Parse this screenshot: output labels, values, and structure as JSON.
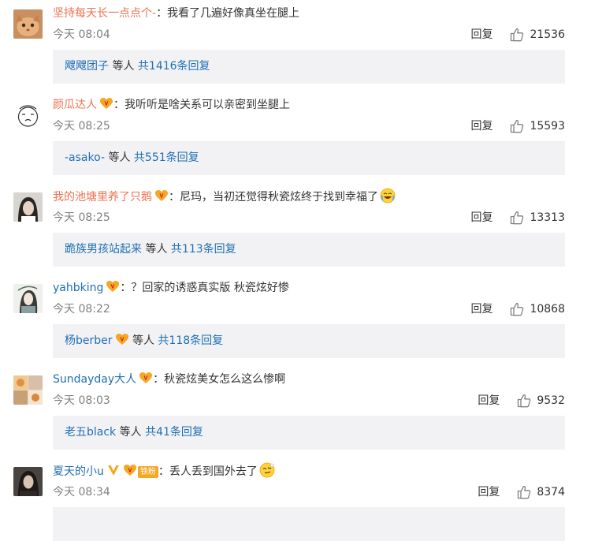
{
  "comments": [
    {
      "user": "坚持每天长一点点个-",
      "text": "：我看了几遍好像真坐在腿上",
      "time": "今天 08:04",
      "reply": "回复",
      "likes": "21536",
      "sub_user": "飕飕团子",
      "sub_mid": "等人",
      "sub_total": "共1416条回复",
      "avatar": "cat-avatar"
    },
    {
      "user": "颜瓜达人",
      "text": "：我听听是啥关系可以亲密到坐腿上",
      "time": "今天 08:25",
      "reply": "回复",
      "likes": "15593",
      "sub_user": "-asako-",
      "sub_mid": "等人",
      "sub_total": "共551条回复",
      "avatar": "cartoon-avatar"
    },
    {
      "user": "我的池塘里养了只鹅",
      "text": "：尼玛，当初还觉得秋瓷炫终于找到幸福了",
      "time": "今天 08:25",
      "reply": "回复",
      "likes": "13313",
      "sub_user": "跪族男孩站起来",
      "sub_mid": "等人",
      "sub_total": "共113条回复",
      "avatar": "girl-avatar"
    },
    {
      "user": "yahbking",
      "text": "：？回家的诱惑真实版 秋瓷炫好惨",
      "time": "今天 08:22",
      "reply": "回复",
      "likes": "10868",
      "sub_user": "杨berber",
      "sub_mid": "等人",
      "sub_total": "共118条回复",
      "avatar": "drawing-avatar"
    },
    {
      "user": "Sundayday大人",
      "text": "：秋瓷炫美女怎么这么惨啊",
      "time": "今天 08:03",
      "reply": "回复",
      "likes": "9532",
      "sub_user": "老五black",
      "sub_mid": "等人",
      "sub_total": "共41条回复",
      "avatar": "photo-avatar"
    },
    {
      "user": "夏天的小u",
      "text": "：丢人丢到国外去了",
      "time": "今天 08:34",
      "reply": "回复",
      "likes": "8374",
      "badge_text": "铁粉",
      "avatar": "dark-avatar"
    }
  ],
  "colors": {
    "username": "#eb7350",
    "link_blue": "#1e6fb4",
    "sub_bg": "#f2f2f5",
    "time": "#808080"
  }
}
